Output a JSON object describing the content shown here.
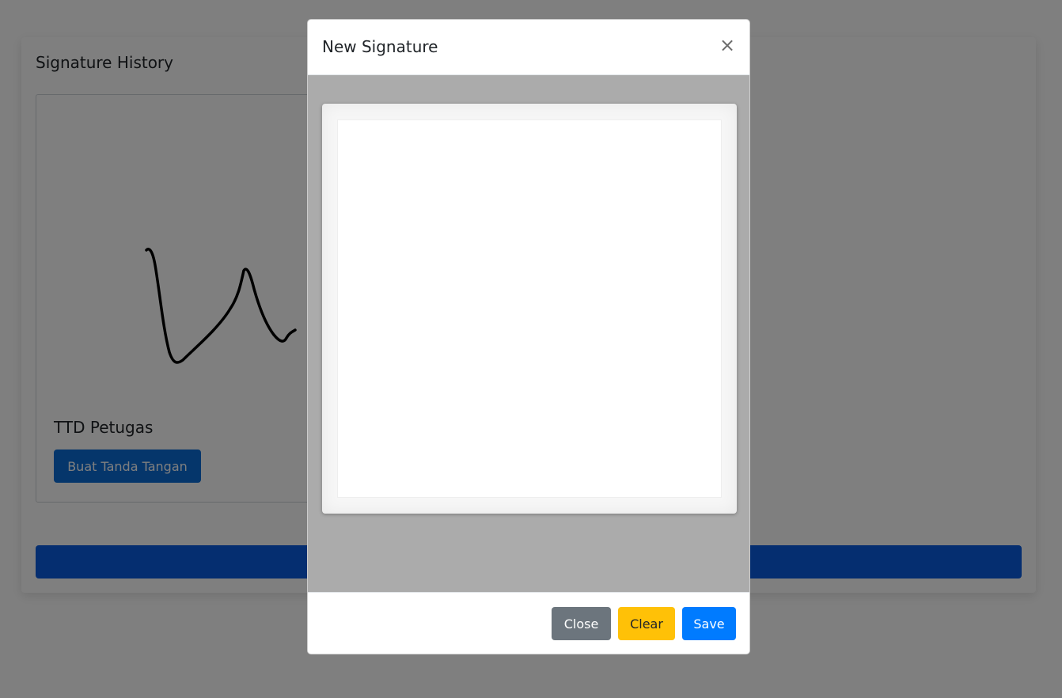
{
  "page": {
    "card_title": "Signature History",
    "signature_label": "TTD Petugas",
    "create_signature_button": "Buat Tanda Tangan"
  },
  "modal": {
    "title": "New Signature",
    "close_icon": "×",
    "buttons": {
      "close": "Close",
      "clear": "Clear",
      "save": "Save"
    }
  },
  "colors": {
    "primary": "#007bff",
    "secondary": "#6c757d",
    "warning": "#ffc107",
    "dark_primary": "#0a5ce0",
    "backdrop": "rgba(0,0,0,0.5)"
  }
}
